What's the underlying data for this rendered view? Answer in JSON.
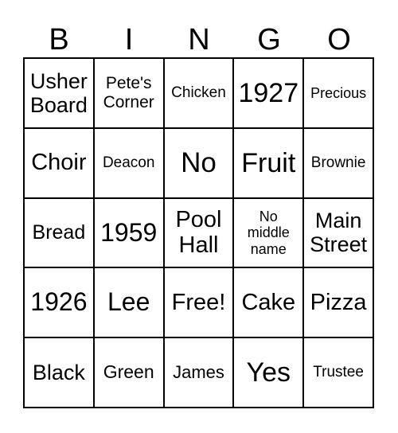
{
  "header": [
    "B",
    "I",
    "N",
    "G",
    "O"
  ],
  "cells": [
    "Usher Board",
    "Pete's Corner",
    "Chicken",
    "1927",
    "Precious",
    "Choir",
    "Deacon",
    "No",
    "Fruit",
    "Brownie",
    "Bread",
    "1959",
    "Pool Hall",
    "No middle name",
    "Main Street",
    "1926",
    "Lee",
    "Free!",
    "Cake",
    "Pizza",
    "Black",
    "Green",
    "James",
    "Yes",
    "Trustee"
  ]
}
